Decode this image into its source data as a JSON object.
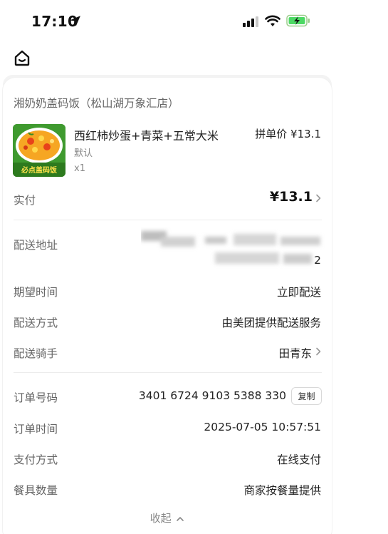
{
  "status_bar": {
    "time": "17:10",
    "icons": [
      "location-arrow-icon",
      "signal-icon",
      "wifi-icon",
      "battery-charging-icon"
    ],
    "battery_color": "#4cd964"
  },
  "nav": {
    "home_icon": "home-icon"
  },
  "shop": {
    "name": "湘奶奶盖码饭（松山湖万象汇店）"
  },
  "item": {
    "title": "西红柿炒蛋+青菜+五常大米",
    "spec": "默认",
    "quantity": "x1",
    "price": "拼单价 ¥13.1",
    "image_text": "必点盖码饭"
  },
  "payment_summary": {
    "label": "实付",
    "value": "¥13.1"
  },
  "delivery": {
    "address_label": "配送地址",
    "address_value_visible": "2",
    "expected_time_label": "期望时间",
    "expected_time_value": "立即配送",
    "method_label": "配送方式",
    "method_value": "由美团提供配送服务",
    "rider_label": "配送骑手",
    "rider_value": "田青东"
  },
  "order": {
    "number_label": "订单号码",
    "number_value": "3401 6724 9103 5388 330",
    "copy_label": "复制",
    "time_label": "订单时间",
    "time_value": "2025-07-05 10:57:51",
    "pay_method_label": "支付方式",
    "pay_method_value": "在线支付",
    "tableware_label": "餐具数量",
    "tableware_value": "商家按餐量提供"
  },
  "collapse_label": "收起"
}
